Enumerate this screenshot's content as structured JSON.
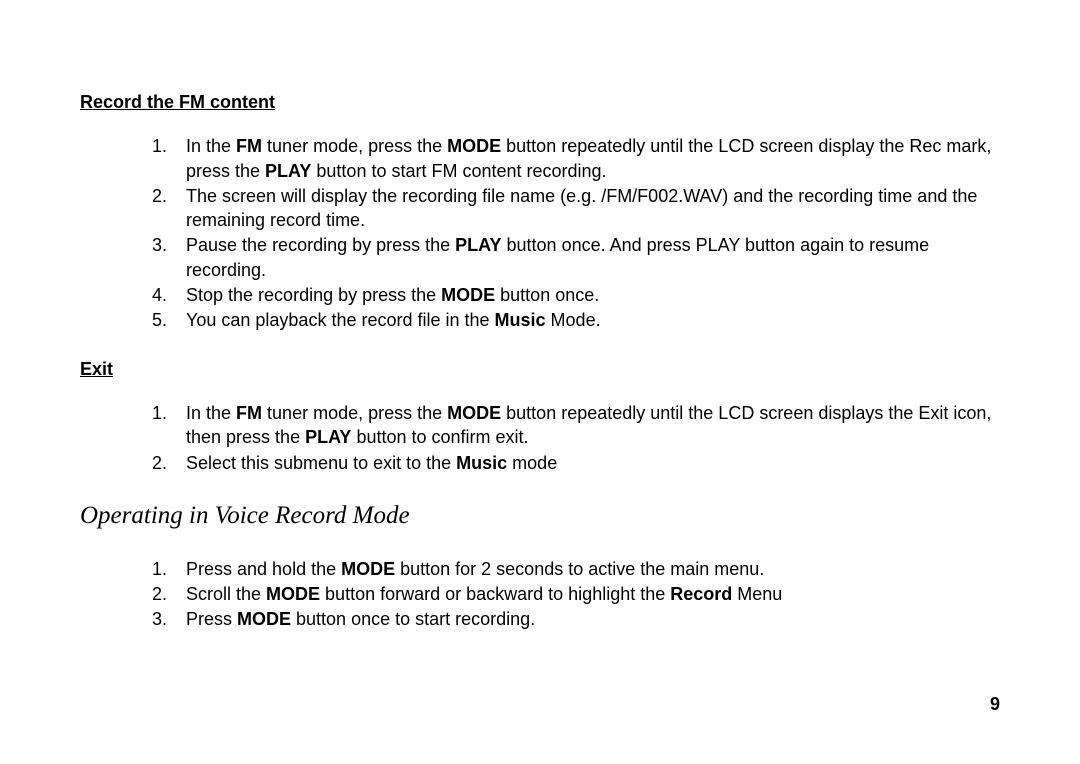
{
  "sections": {
    "recordFM": {
      "heading": "Record the FM content",
      "items": [
        {
          "n": "1.",
          "parts": [
            "In the ",
            "FM",
            " tuner mode, press the ",
            "MODE",
            " button repeatedly until the LCD screen display the Rec mark, press the ",
            "PLAY",
            " button to start FM content recording."
          ]
        },
        {
          "n": "2.",
          "text": "The screen will display the recording file name (e.g. /FM/F002.WAV) and the recording time and the remaining record time."
        },
        {
          "n": "3.",
          "parts": [
            "Pause the recording by press the ",
            "PLAY",
            " button once. And press PLAY button again to resume recording."
          ]
        },
        {
          "n": "4.",
          "parts": [
            "Stop the recording by press the ",
            "MODE",
            " button once."
          ]
        },
        {
          "n": "5.",
          "parts": [
            "You can playback the record file in the ",
            "Music",
            " Mode."
          ]
        }
      ]
    },
    "exit": {
      "heading": "Exit",
      "items": [
        {
          "n": "1.",
          "parts": [
            "In the ",
            "FM",
            " tuner mode, press the ",
            "MODE",
            " button repeatedly until the LCD screen displays the Exit icon, then press the ",
            "PLAY",
            " button to confirm exit."
          ]
        },
        {
          "n": "2.",
          "parts": [
            "Select this submenu to exit to the ",
            "Music",
            " mode"
          ]
        }
      ]
    },
    "voiceRecord": {
      "heading": "Operating in Voice Record Mode",
      "items": [
        {
          "n": "1.",
          "parts": [
            "Press and hold the ",
            "MODE",
            " button for 2 seconds to active the main menu."
          ]
        },
        {
          "n": "2.",
          "parts": [
            "Scroll the ",
            "MODE",
            " button forward or backward to highlight the ",
            "Record",
            " Menu"
          ]
        },
        {
          "n": "3.",
          "parts": [
            "Press ",
            "MODE",
            " button once to start recording."
          ]
        }
      ]
    }
  },
  "pageNumber": "9"
}
